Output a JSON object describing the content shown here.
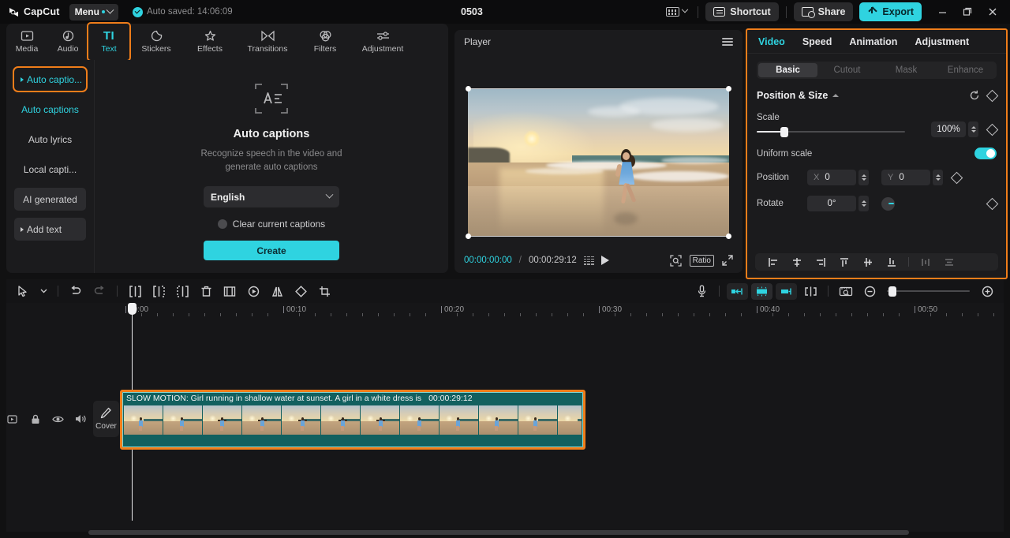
{
  "titlebar": {
    "app_name": "CapCut",
    "menu_label": "Menu",
    "autosave_text": "Auto saved: 14:06:09",
    "project_title": "0503",
    "shortcut_label": "Shortcut",
    "share_label": "Share",
    "export_label": "Export",
    "accent_color": "#2fd3e0",
    "highlight_color": "#ef7d1a",
    "icons": {
      "logo": "capcut-logo-icon",
      "autosave": "check-circle-icon",
      "layout": "keyboard-layout-icon",
      "shortcut": "keyboard-icon",
      "share": "share-icon",
      "export": "upload-icon",
      "minimize": "minimize-icon",
      "maximize": "maximize-icon",
      "close": "close-icon"
    }
  },
  "tabstrip": {
    "tabs": [
      {
        "label": "Media",
        "icon": "media-icon",
        "active": false
      },
      {
        "label": "Audio",
        "icon": "audio-icon",
        "active": false
      },
      {
        "label": "Text",
        "icon": "text-icon",
        "active": true,
        "highlighted": true
      },
      {
        "label": "Stickers",
        "icon": "stickers-icon",
        "active": false
      },
      {
        "label": "Effects",
        "icon": "effects-icon",
        "active": false
      },
      {
        "label": "Transitions",
        "icon": "transitions-icon",
        "active": false
      },
      {
        "label": "Filters",
        "icon": "filters-icon",
        "active": false
      },
      {
        "label": "Adjustment",
        "icon": "adjustment-icon",
        "active": false
      }
    ]
  },
  "left_panel": {
    "nav": [
      {
        "label": "Auto captio...",
        "type": "group",
        "selected": true,
        "highlighted": true
      },
      {
        "label": "Auto captions",
        "type": "sub",
        "active": true
      },
      {
        "label": "Auto lyrics",
        "type": "sub",
        "active": false
      },
      {
        "label": "Local capti...",
        "type": "sub",
        "active": false
      },
      {
        "label": "AI generated",
        "type": "button",
        "active": false
      },
      {
        "label": "Add text",
        "type": "button-group",
        "active": false
      }
    ],
    "content": {
      "icon": "auto-captions-icon",
      "title": "Auto captions",
      "description": "Recognize speech in the video and generate auto captions",
      "language_value": "English",
      "checkbox_label": "Clear current captions",
      "checkbox_checked": false,
      "create_label": "Create"
    }
  },
  "player": {
    "title": "Player",
    "current_time": "00:00:00:00",
    "separator": "/",
    "total_time": "00:00:29:12",
    "ratio_label": "Ratio",
    "icons": {
      "menu": "hamburger-icon",
      "grid": "grid-icon",
      "play": "play-icon",
      "zoom": "zoom-fit-icon",
      "expand": "fullscreen-icon"
    }
  },
  "right_panel": {
    "tabs": [
      {
        "label": "Video",
        "active": true
      },
      {
        "label": "Speed",
        "active": false
      },
      {
        "label": "Animation",
        "active": false
      },
      {
        "label": "Adjustment",
        "active": false
      }
    ],
    "subtabs": [
      {
        "label": "Basic",
        "active": true
      },
      {
        "label": "Cutout",
        "active": false
      },
      {
        "label": "Mask",
        "active": false
      },
      {
        "label": "Enhance",
        "active": false
      }
    ],
    "section_title": "Position & Size",
    "scale": {
      "label": "Scale",
      "value": "100%",
      "percent": 18
    },
    "uniform_scale": {
      "label": "Uniform scale",
      "on": true
    },
    "position": {
      "label": "Position",
      "x_label": "X",
      "x_value": "0",
      "y_label": "Y",
      "y_value": "0"
    },
    "rotate": {
      "label": "Rotate",
      "value": "0°"
    },
    "align_buttons": [
      "align-left-icon",
      "align-center-horizontal-icon",
      "align-right-icon",
      "align-top-icon",
      "align-middle-vertical-icon",
      "align-bottom-icon",
      "distribute-horizontal-icon",
      "distribute-vertical-icon"
    ]
  },
  "timeline_toolbar": {
    "left_icons": [
      "select-tool-icon",
      "tool-dropdown-icon",
      "undo-icon",
      "redo-icon",
      "split-icon",
      "trim-left-icon",
      "trim-right-icon",
      "delete-icon",
      "freeze-frame-icon",
      "reverse-icon",
      "mirror-icon",
      "rotate-icon",
      "crop-icon"
    ],
    "right_icons": [
      "microphone-icon",
      "snap-left-icon",
      "snap-center-icon",
      "snap-right-icon",
      "split-marker-icon",
      "preview-ruler-icon",
      "zoom-out-icon",
      "zoom-in-icon"
    ]
  },
  "timeline": {
    "ruler_labels": [
      "00:00",
      "00:10",
      "00:20",
      "00:30",
      "00:40",
      "00:50"
    ],
    "track_controls": [
      "record-icon",
      "lock-icon",
      "eye-icon",
      "volume-icon"
    ],
    "cover_label": "Cover",
    "clip": {
      "name": "SLOW MOTION: Girl running in shallow water at sunset. A girl in a white dress is",
      "duration": "00:00:29:12",
      "selected": true,
      "frame_count": 12
    }
  }
}
